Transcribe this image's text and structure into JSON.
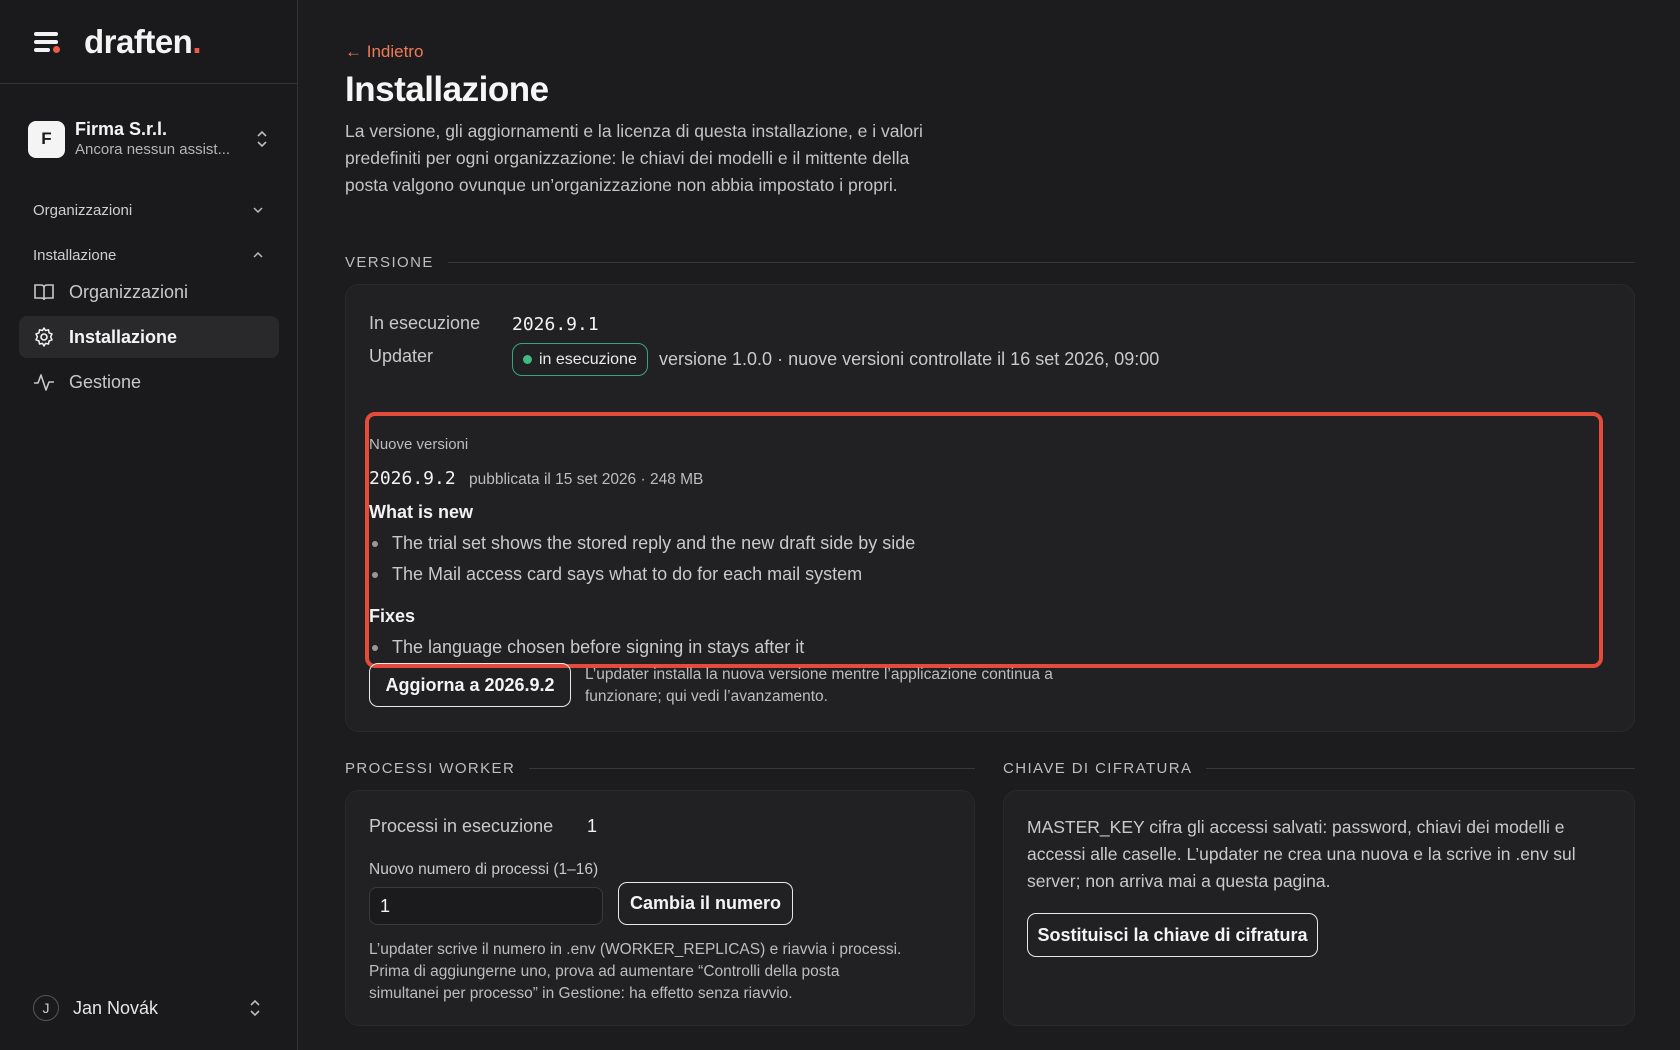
{
  "brand": {
    "name": "draften",
    "dot": "."
  },
  "org": {
    "initial": "F",
    "name": "Firma S.r.l.",
    "subtitle": "Ancora nessun assist..."
  },
  "sidebar": {
    "group_orgs": "Organizzazioni",
    "group_install": "Installazione",
    "items": [
      {
        "label": "Organizzazioni",
        "icon": "book-icon"
      },
      {
        "label": "Installazione",
        "icon": "gear-icon"
      },
      {
        "label": "Gestione",
        "icon": "activity-icon"
      }
    ]
  },
  "user": {
    "initial": "J",
    "name": "Jan Novák"
  },
  "page": {
    "back": "← Indietro",
    "title": "Installazione",
    "intro": "La versione, gli aggiornamenti e la licenza di questa installazione, e i valori predefiniti per ogni organizzazione: le chiavi dei modelli e il mittente della posta valgono ovunque un’organizzazione non abbia impostato i propri."
  },
  "version": {
    "section": "VERSIONE",
    "running_label": "In esecuzione",
    "running_value": "2026.9.1",
    "updater_label": "Updater",
    "updater_status": "in esecuzione",
    "updater_info": "versione 1.0.0 · nuove versioni controllate il 16 set 2026, 09:00",
    "new_label": "Nuove versioni",
    "new_version": "2026.9.2",
    "new_meta": "pubblicata il 15 set 2026 · 248 MB",
    "whats_new_title": "What is new",
    "whats_new": [
      "The trial set shows the stored reply and the new draft side by side",
      "The Mail access card says what to do for each mail system"
    ],
    "fixes_title": "Fixes",
    "fixes": [
      "The language chosen before signing in stays after it"
    ],
    "update_button": "Aggiorna a 2026.9.2",
    "update_help": "L’updater installa la nuova versione mentre l’applicazione continua a funzionare; qui vedi l’avanzamento."
  },
  "workers": {
    "section": "PROCESSI WORKER",
    "running_label": "Processi in esecuzione",
    "running_value": "1",
    "new_label": "Nuovo numero di processi (1–16)",
    "input_value": "1",
    "button": "Cambia il numero",
    "help": "L’updater scrive il numero in .env (WORKER_REPLICAS) e riavvia i processi. Prima di aggiungerne uno, prova ad aumentare “Controlli della posta simultanei per processo” in Gestione: ha effetto senza riavvio."
  },
  "encryption": {
    "section": "CHIAVE DI CIFRATURA",
    "text": "MASTER_KEY cifra gli accessi salvati: password, chiavi dei modelli e accessi alle caselle. L’updater ne crea una nuova e la scrive in .env sul server; non arriva mai a questa pagina.",
    "button": "Sostituisci la chiave di cifratura"
  },
  "colors": {
    "accent": "#ee5a43",
    "status": "#3fb985",
    "highlight": "#e54b3b",
    "background": "#1c1c1e"
  }
}
